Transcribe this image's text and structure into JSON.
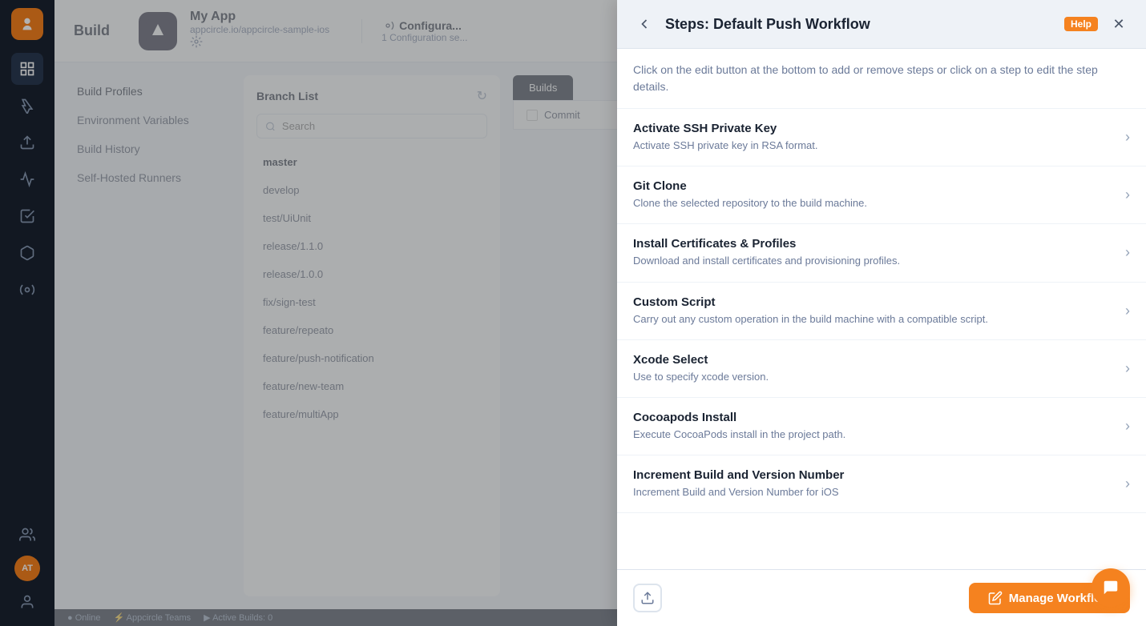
{
  "app": {
    "name": "My App",
    "repo": "appcircle.io/appcircle-sample-ios",
    "config_label": "Configura...",
    "config_sub": "1 Configuration se..."
  },
  "sidebar": {
    "status": "Online",
    "team": "Appcircle Teams",
    "active_builds": "Active Builds: 0",
    "avatar": "AT"
  },
  "nav": {
    "items": [
      {
        "label": "Build Profiles",
        "active": true
      },
      {
        "label": "Environment Variables",
        "active": false
      },
      {
        "label": "Build History",
        "active": false
      },
      {
        "label": "Self-Hosted Runners",
        "active": false
      }
    ]
  },
  "page_title": "Build",
  "branch_list": {
    "title": "Branch List",
    "search_placeholder": "Search",
    "branches": [
      {
        "name": "master",
        "active": true
      },
      {
        "name": "develop",
        "active": false
      },
      {
        "name": "test/UiUnit",
        "active": false
      },
      {
        "name": "release/1.1.0",
        "active": false
      },
      {
        "name": "release/1.0.0",
        "active": false
      },
      {
        "name": "fix/sign-test",
        "active": false
      },
      {
        "name": "feature/repeato",
        "active": false
      },
      {
        "name": "feature/push-notification",
        "active": false
      },
      {
        "name": "feature/new-team",
        "active": false
      },
      {
        "name": "feature/multiApp",
        "active": false
      }
    ]
  },
  "builds_tab": "Builds",
  "commit_header": "Commit",
  "drawer": {
    "back_label": "back",
    "title": "Steps: Default Push Workflow",
    "help_label": "Help",
    "close_label": "close",
    "description": "Click on the edit button at the bottom to add or remove steps or click on a step to edit the step details.",
    "steps": [
      {
        "title": "Activate SSH Private Key",
        "desc": "Activate SSH private key in RSA format."
      },
      {
        "title": "Git Clone",
        "desc": "Clone the selected repository to the build machine."
      },
      {
        "title": "Install Certificates & Profiles",
        "desc": "Download and install certificates and provisioning profiles."
      },
      {
        "title": "Custom Script",
        "desc": "Carry out any custom operation in the build machine with a compatible script."
      },
      {
        "title": "Xcode Select",
        "desc": "Use to specify xcode version."
      },
      {
        "title": "Cocoapods Install",
        "desc": "Execute CocoaPods install in the project path."
      },
      {
        "title": "Increment Build and Version Number",
        "desc": "Increment Build and Version Number for iOS"
      }
    ],
    "footer": {
      "manage_label": "Manage Workflow"
    }
  },
  "icons": {
    "build": "🔨",
    "test": "⚗",
    "publish": "📦",
    "settings": "⚙",
    "users": "👥",
    "integrations": "🔗",
    "variables": "📊",
    "search": "🔍"
  }
}
